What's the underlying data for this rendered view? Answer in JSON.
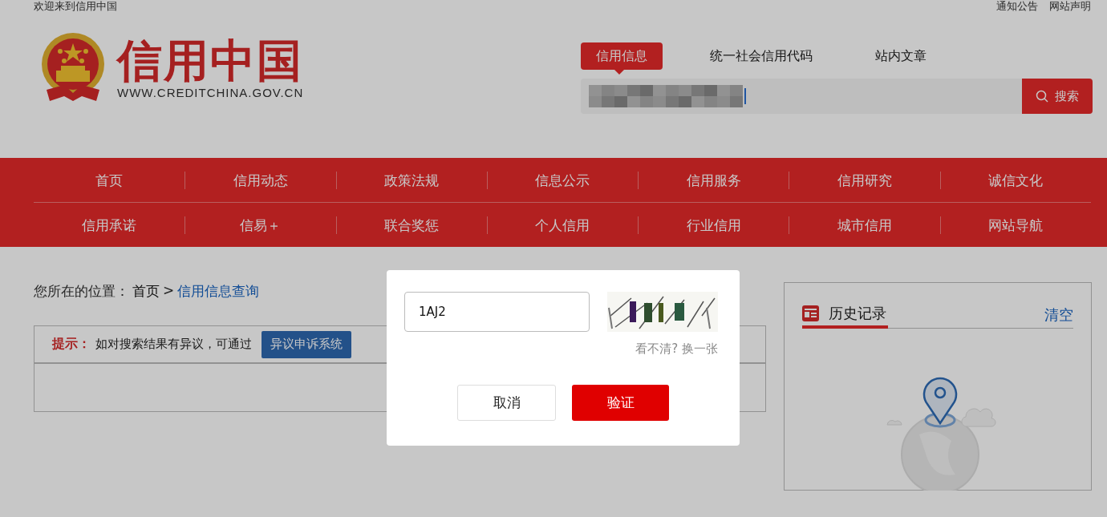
{
  "top_bar": {
    "welcome": "欢迎来到信用中国",
    "links": [
      "通知公告",
      "网站声明"
    ]
  },
  "logo": {
    "title": "信用中国",
    "url": "WWW.CREDITCHINA.GOV.CN"
  },
  "search": {
    "tabs": [
      {
        "label": "信用信息",
        "selected": true
      },
      {
        "label": "统一社会信用代码",
        "selected": false
      },
      {
        "label": "站内文章",
        "selected": false
      }
    ],
    "button": "搜索"
  },
  "nav": {
    "rows": [
      [
        "首页",
        "信用动态",
        "政策法规",
        "信息公示",
        "信用服务",
        "信用研究",
        "诚信文化"
      ],
      [
        "信用承诺",
        "信易＋",
        "联合奖惩",
        "个人信用",
        "行业信用",
        "城市信用",
        "网站导航"
      ]
    ]
  },
  "breadcrumb": {
    "label": "您所在的位置：",
    "separator": ">",
    "items": [
      {
        "text": "首页",
        "kind": "plain"
      },
      {
        "text": "信用信息查询",
        "kind": "link"
      }
    ]
  },
  "notice": {
    "label": "提示：",
    "text": "如对搜索结果有异议，可通过",
    "button": "异议申诉系统"
  },
  "history": {
    "title": "历史记录",
    "clear": "清空"
  },
  "dialog": {
    "value": "1AJ2",
    "refresh": "看不清? 换一张",
    "buttons": [
      {
        "label": "取消",
        "kind": "secondary"
      },
      {
        "label": "验证",
        "kind": "primary"
      }
    ]
  }
}
